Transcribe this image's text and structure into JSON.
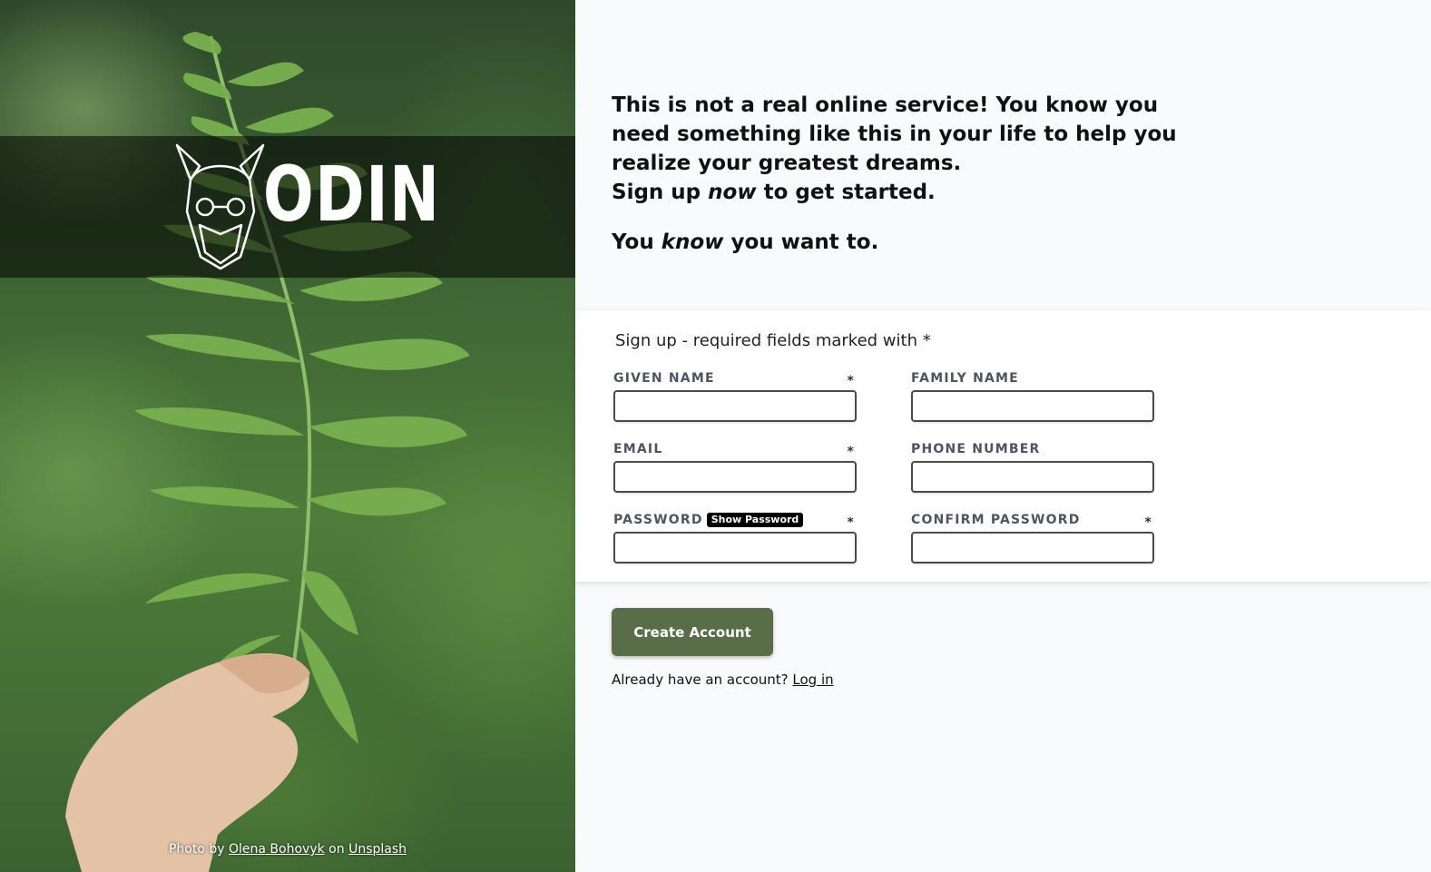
{
  "hero": {
    "logo_text": "ODIN",
    "credit": {
      "prefix": "Photo by",
      "author": "Olena Bohovyk",
      "middle": "on",
      "site": "Unsplash"
    }
  },
  "intro": {
    "line1": "This is not a real online service! You know you need something like this in your life to help you realize your greatest dreams.",
    "signup_pre": "Sign up ",
    "signup_em": "now",
    "signup_post": " to get started.",
    "know_pre": "You ",
    "know_em": "know",
    "know_post": " you want to."
  },
  "form": {
    "title": "Sign up - required fields marked with *",
    "required_mark": "*",
    "fields": {
      "given_name": {
        "label": "GIVEN NAME",
        "value": ""
      },
      "family_name": {
        "label": "FAMILY NAME",
        "value": ""
      },
      "email": {
        "label": "EMAIL",
        "value": ""
      },
      "phone": {
        "label": "PHONE NUMBER",
        "value": ""
      },
      "password": {
        "label": "PASSWORD",
        "value": ""
      },
      "confirm_password": {
        "label": "CONFIRM PASSWORD",
        "value": ""
      }
    },
    "show_password_label": "Show Password"
  },
  "actions": {
    "create_label": "Create Account",
    "login_prompt": "Already have an account?",
    "login_link": "Log in"
  },
  "colors": {
    "button": "#596d48",
    "panel_bg": "#ffffff",
    "page_bg": "#f9fafb"
  }
}
